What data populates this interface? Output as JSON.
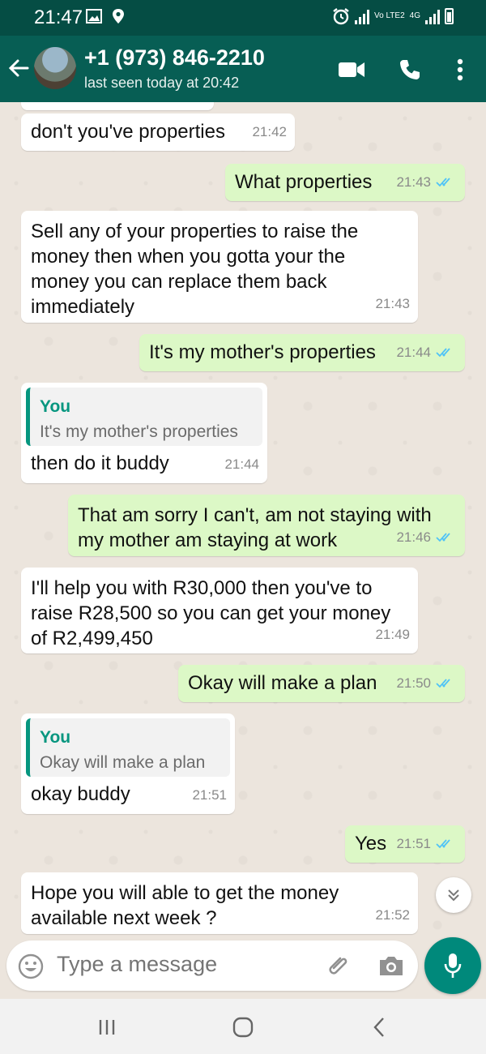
{
  "status_bar": {
    "time": "21:47",
    "network_label": "4G",
    "volte_label": "Vo LTE2"
  },
  "header": {
    "contact": "+1 (973) 846-2210",
    "last_seen": "last seen today at 20:42",
    "icons": [
      "back-arrow-icon",
      "video-call-icon",
      "phone-icon",
      "more-options-icon"
    ]
  },
  "messages": [
    {
      "dir": "in",
      "text": "don't you've properties",
      "time": "21:42"
    },
    {
      "dir": "out",
      "text": "What  properties",
      "time": "21:43",
      "status": "read"
    },
    {
      "dir": "in",
      "lines": [
        "Sell any of your properties to raise the",
        "money then when you gotta your the",
        "money you can replace them back",
        "immediately"
      ],
      "time": "21:43"
    },
    {
      "dir": "out",
      "text": "It's my mother's properties",
      "time": "21:44",
      "status": "read"
    },
    {
      "dir": "in",
      "quote": {
        "author": "You",
        "text": "It's my mother's properties"
      },
      "text": "then do it buddy",
      "time": "21:44"
    },
    {
      "dir": "out",
      "lines": [
        "That  am sorry  I can't, am not staying with",
        "my mother am staying at work"
      ],
      "time": "21:46",
      "status": "read"
    },
    {
      "dir": "in",
      "lines": [
        "I'll help you with R30,000 then you've to",
        "raise R28,500 so you can get your money",
        "of R2,499,450"
      ],
      "time": "21:49"
    },
    {
      "dir": "out",
      "text": "Okay  will make a plan",
      "time": "21:50",
      "status": "read"
    },
    {
      "dir": "in",
      "quote": {
        "author": "You",
        "text": "Okay  will make a plan"
      },
      "text": "okay buddy",
      "time": "21:51"
    },
    {
      "dir": "out",
      "text": "Yes",
      "time": "21:51",
      "status": "read"
    },
    {
      "dir": "in",
      "lines": [
        "Hope you will able to get the money",
        "available next week ?"
      ],
      "time": "21:52"
    }
  ],
  "input": {
    "placeholder": "Type a message"
  },
  "colors": {
    "header": "#075e54",
    "status_bar": "#054d44",
    "outgoing": "#dcf8c6",
    "incoming": "#ffffff",
    "accent": "#00897b",
    "read_ticks": "#4fc3f7"
  }
}
